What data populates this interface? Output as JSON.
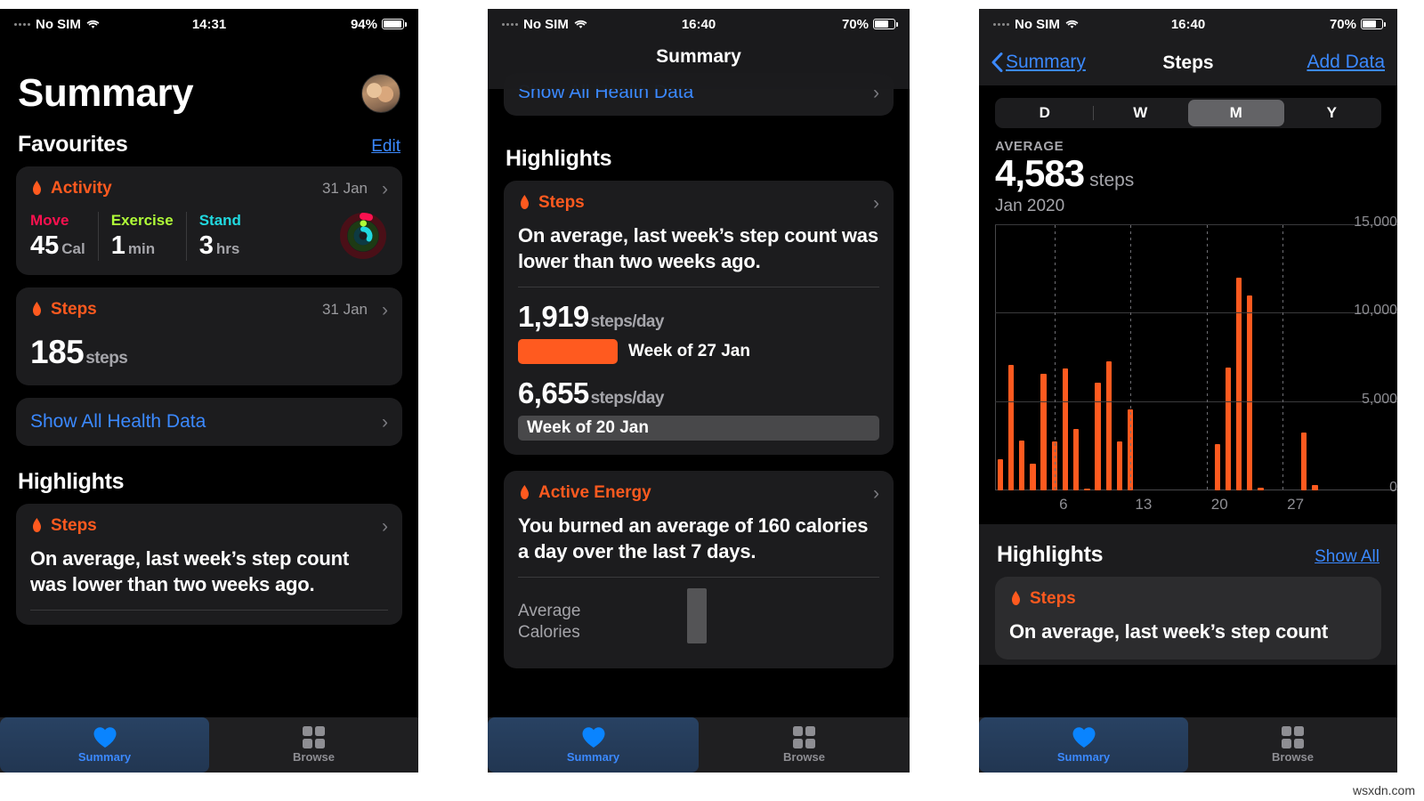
{
  "watermark": "wsxdn.com",
  "colors": {
    "accent_orange": "#ff5a1f",
    "link_blue": "#3b89ff",
    "move_pink": "#fa114f",
    "exercise_green": "#b0fc38",
    "stand_cyan": "#21d9e0",
    "card_bg": "#1c1c1e",
    "screen_bg": "#000000"
  },
  "panel1": {
    "status": {
      "carrier": "No SIM",
      "time": "14:31",
      "battery": "94%",
      "battery_pct": 94
    },
    "title": "Summary",
    "favourites_label": "Favourites",
    "edit_label": "Edit",
    "activity_card": {
      "title": "Activity",
      "date": "31 Jan",
      "metrics": [
        {
          "label": "Move",
          "value": "45",
          "unit": "Cal"
        },
        {
          "label": "Exercise",
          "value": "1",
          "unit": "min"
        },
        {
          "label": "Stand",
          "value": "3",
          "unit": "hrs"
        }
      ]
    },
    "steps_card": {
      "title": "Steps",
      "date": "31 Jan",
      "value": "185",
      "unit": "steps"
    },
    "show_all_label": "Show All Health Data",
    "highlights_label": "Highlights",
    "highlight_card": {
      "title": "Steps",
      "body": "On average, last week’s step count was lower than two weeks ago."
    },
    "tabs": [
      {
        "label": "Summary",
        "icon": "heart-icon",
        "active": true
      },
      {
        "label": "Browse",
        "icon": "grid-icon",
        "active": false
      }
    ]
  },
  "panel2": {
    "status": {
      "carrier": "No SIM",
      "time": "16:40",
      "battery": "70%",
      "battery_pct": 70
    },
    "nav_title": "Summary",
    "scrolled_row_label": "Show All Health Data",
    "highlights_label": "Highlights",
    "steps_card": {
      "title": "Steps",
      "body": "On average, last week’s step count was lower than two weeks ago.",
      "comparisons": [
        {
          "value": "1,919",
          "unit": "steps/day",
          "label": "Week of 27 Jan",
          "style": "orange"
        },
        {
          "value": "6,655",
          "unit": "steps/day",
          "label": "Week of 20 Jan",
          "style": "grey"
        }
      ]
    },
    "energy_card": {
      "title": "Active Energy",
      "body": "You burned an average of 160 calories a day over the last 7 days.",
      "axis_label_line1": "Average",
      "axis_label_line2": "Calories"
    },
    "tabs": [
      {
        "label": "Summary",
        "icon": "heart-icon",
        "active": true
      },
      {
        "label": "Browse",
        "icon": "grid-icon",
        "active": false
      }
    ]
  },
  "panel3": {
    "status": {
      "carrier": "No SIM",
      "time": "16:40",
      "battery": "70%",
      "battery_pct": 70
    },
    "nav_back_label": "Summary",
    "nav_title": "Steps",
    "nav_action_label": "Add Data",
    "segments": [
      {
        "label": "D",
        "selected": false
      },
      {
        "label": "W",
        "selected": false
      },
      {
        "label": "M",
        "selected": true
      },
      {
        "label": "Y",
        "selected": false
      }
    ],
    "stat": {
      "label": "AVERAGE",
      "value": "4,583",
      "unit": "steps",
      "period": "Jan 2020"
    },
    "highlights_label": "Highlights",
    "show_all_label": "Show All",
    "highlight_card": {
      "title": "Steps",
      "body": "On average, last week’s step count"
    },
    "tabs": [
      {
        "label": "Summary",
        "icon": "heart-icon",
        "active": true
      },
      {
        "label": "Browse",
        "icon": "grid-icon",
        "active": false
      }
    ]
  },
  "chart_data": {
    "type": "bar",
    "title": "Steps",
    "subtitle": "Jan 2020",
    "xlabel": "",
    "ylabel": "steps",
    "ylim": [
      0,
      15000
    ],
    "yticks": [
      0,
      5000,
      10000,
      15000
    ],
    "ytick_labels": [
      "0",
      "5,000",
      "10,000",
      "15,000"
    ],
    "xticks": [
      6,
      13,
      20,
      27
    ],
    "xtick_labels": [
      "6",
      "13",
      "20",
      "27"
    ],
    "grid": true,
    "legend": "none",
    "average": 4583,
    "x": [
      1,
      2,
      3,
      4,
      5,
      6,
      7,
      8,
      9,
      10,
      11,
      12,
      13,
      14,
      15,
      16,
      17,
      18,
      19,
      20,
      21,
      22,
      23,
      24,
      25,
      26,
      27,
      28,
      29,
      30,
      31
    ],
    "values": [
      1750,
      7100,
      2800,
      1500,
      6600,
      2750,
      6900,
      3450,
      120,
      6100,
      7300,
      2750,
      4600,
      0,
      0,
      0,
      0,
      0,
      0,
      0,
      2600,
      6950,
      12050,
      11000,
      150,
      0,
      0,
      0,
      3250,
      280,
      0
    ]
  }
}
